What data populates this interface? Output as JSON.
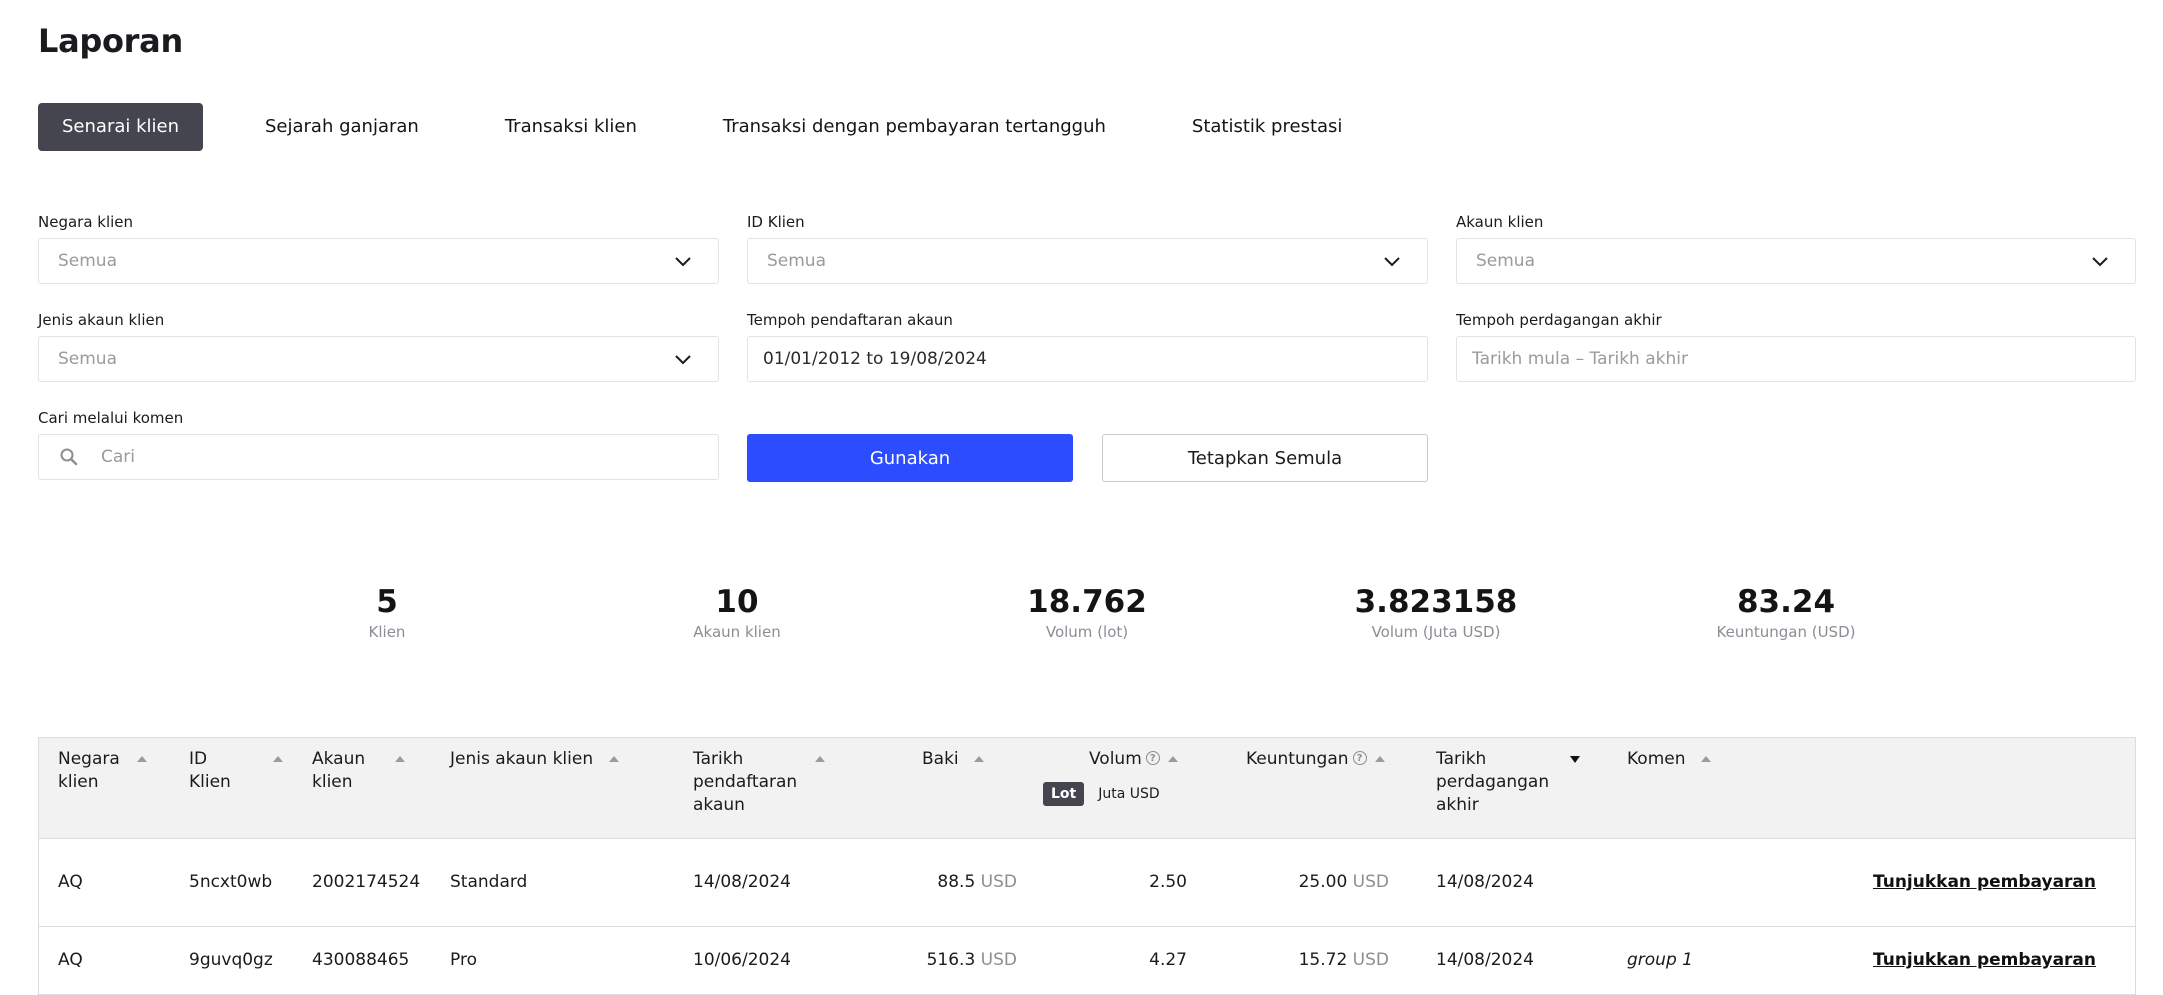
{
  "page_title": "Laporan",
  "tabs": [
    {
      "label": "Senarai klien",
      "active": true
    },
    {
      "label": "Sejarah ganjaran",
      "active": false
    },
    {
      "label": "Transaksi klien",
      "active": false
    },
    {
      "label": "Transaksi dengan pembayaran tertangguh",
      "active": false
    },
    {
      "label": "Statistik prestasi",
      "active": false
    }
  ],
  "filters": {
    "client_country": {
      "label": "Negara klien",
      "value": "Semua"
    },
    "client_id": {
      "label": "ID Klien",
      "value": "Semua"
    },
    "client_account": {
      "label": "Akaun klien",
      "value": "Semua"
    },
    "account_type": {
      "label": "Jenis akaun klien",
      "value": "Semua"
    },
    "registration_period": {
      "label": "Tempoh pendaftaran akaun",
      "value": "01/01/2012 to 19/08/2024"
    },
    "last_trading_period": {
      "label": "Tempoh perdagangan akhir",
      "placeholder": "Tarikh mula – Tarikh akhir"
    },
    "comment_search": {
      "label": "Cari melalui komen",
      "placeholder": "Cari"
    }
  },
  "buttons": {
    "apply": "Gunakan",
    "reset": "Tetapkan Semula"
  },
  "stats": [
    {
      "value": "5",
      "label": "Klien"
    },
    {
      "value": "10",
      "label": "Akaun klien"
    },
    {
      "value": "18.762",
      "label": "Volum (lot)"
    },
    {
      "value": "3.823158",
      "label": "Volum (Juta USD)"
    },
    {
      "value": "83.24",
      "label": "Keuntungan (USD)"
    }
  ],
  "table": {
    "headers": {
      "country": [
        "Negara",
        "klien"
      ],
      "client_id": [
        "ID",
        "Klien"
      ],
      "account": [
        "Akaun",
        "klien"
      ],
      "account_type": "Jenis akaun klien",
      "registration_date": [
        "Tarikh",
        "pendaftaran",
        "akaun"
      ],
      "balance": "Baki",
      "volume": "Volum",
      "profit": "Keuntungan",
      "last_trade_date": [
        "Tarikh",
        "perdagangan",
        "akhir"
      ],
      "comment": "Komen"
    },
    "volume_units": {
      "selected": "Lot",
      "other": "Juta USD"
    },
    "rows": [
      {
        "country": "AQ",
        "client_id": "5ncxt0wb",
        "account": "2002174524",
        "account_type": "Standard",
        "registration_date": "14/08/2024",
        "balance": "88.5",
        "balance_cur": "USD",
        "volume": "2.50",
        "profit": "25.00",
        "profit_cur": "USD",
        "last_trade_date": "14/08/2024",
        "comment": "",
        "action": "Tunjukkan pembayaran"
      },
      {
        "country": "AQ",
        "client_id": "9guvq0gz",
        "account": "430088465",
        "account_type": "Pro",
        "registration_date": "10/06/2024",
        "balance": "516.3",
        "balance_cur": "USD",
        "volume": "4.27",
        "profit": "15.72",
        "profit_cur": "USD",
        "last_trade_date": "14/08/2024",
        "comment": "group 1",
        "action": "Tunjukkan pembayaran"
      }
    ]
  }
}
